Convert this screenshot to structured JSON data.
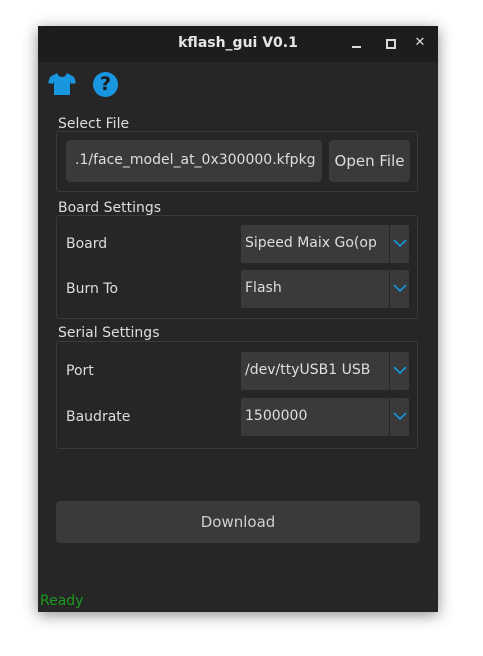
{
  "window": {
    "title": "kflash_gui V0.1"
  },
  "titlebar": {
    "minimize_glyph": "_",
    "maximize_glyph": "□",
    "close_glyph": "✕"
  },
  "toolbar": {
    "skin_icon": "t-shirt-icon",
    "help_icon": "question-icon",
    "help_glyph": "?"
  },
  "select_file": {
    "title": "Select File",
    "path": ".1/face_model_at_0x300000.kfpkg",
    "open_label": "Open File"
  },
  "board_settings": {
    "title": "Board Settings",
    "board_label": "Board",
    "board_value": "Sipeed Maix Go(op",
    "burn_label": "Burn To",
    "burn_value": "Flash"
  },
  "serial_settings": {
    "title": "Serial Settings",
    "port_label": "Port",
    "port_value": "/dev/ttyUSB1 USB",
    "baud_label": "Baudrate",
    "baud_value": "1500000"
  },
  "download": {
    "label": "Download"
  },
  "status": {
    "text": "Ready"
  },
  "colors": {
    "accent": "#1896e0",
    "status_ok": "#1d9c1d",
    "background": "#262626",
    "control": "#3a3a3a"
  }
}
